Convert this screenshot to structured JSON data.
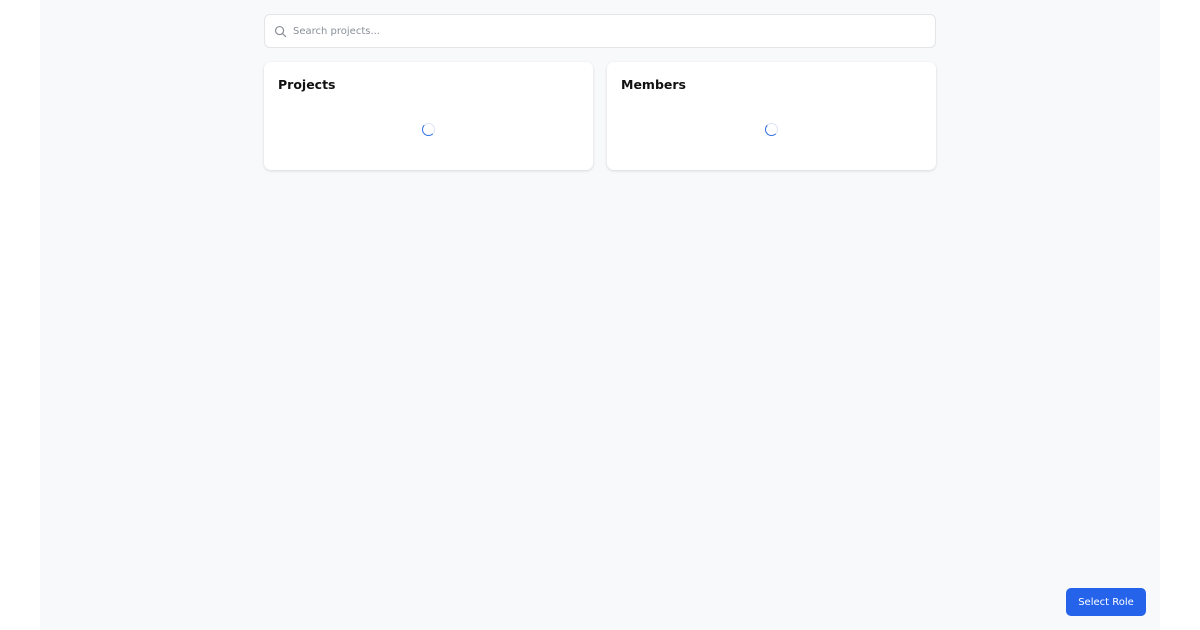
{
  "search": {
    "placeholder": "Search projects...",
    "value": ""
  },
  "cards": {
    "projects": {
      "title": "Projects"
    },
    "members": {
      "title": "Members"
    }
  },
  "actions": {
    "select_role_label": "Select Role"
  },
  "colors": {
    "accent": "#2563eb",
    "background": "#f8f9fb",
    "card": "#ffffff"
  }
}
